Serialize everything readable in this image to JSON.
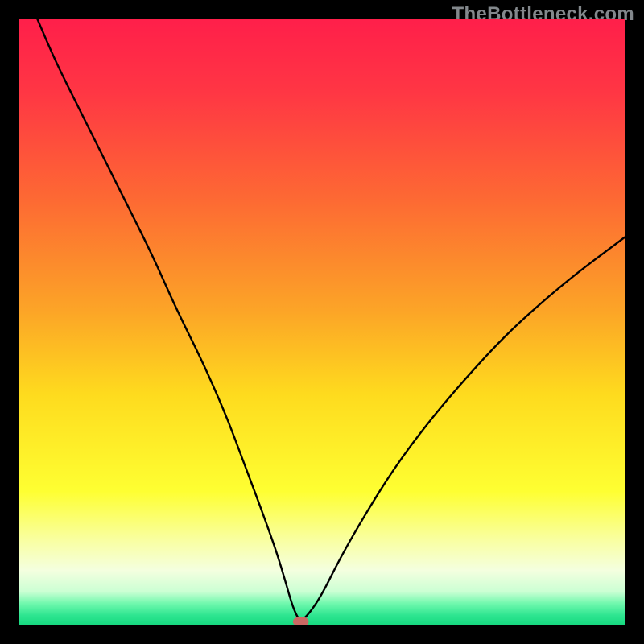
{
  "watermark_text": "TheBottleneck.com",
  "chart_data": {
    "type": "line",
    "title": "",
    "xlabel": "",
    "ylabel": "",
    "xlim": [
      0,
      100
    ],
    "ylim": [
      0,
      100
    ],
    "grid": false,
    "legend": false,
    "gradient_stops": [
      {
        "offset": 0.0,
        "color": "#ff1f4a"
      },
      {
        "offset": 0.12,
        "color": "#ff3644"
      },
      {
        "offset": 0.3,
        "color": "#fd6a33"
      },
      {
        "offset": 0.48,
        "color": "#fca427"
      },
      {
        "offset": 0.62,
        "color": "#fedb1e"
      },
      {
        "offset": 0.78,
        "color": "#feff32"
      },
      {
        "offset": 0.86,
        "color": "#f9ffa1"
      },
      {
        "offset": 0.91,
        "color": "#f4ffdf"
      },
      {
        "offset": 0.945,
        "color": "#ccffd4"
      },
      {
        "offset": 0.965,
        "color": "#70f8ad"
      },
      {
        "offset": 0.985,
        "color": "#2de590"
      },
      {
        "offset": 1.0,
        "color": "#17d980"
      }
    ],
    "series": [
      {
        "name": "bottleneck-curve",
        "color": "#000000",
        "x": [
          3,
          6,
          10,
          14,
          18,
          22,
          26,
          30,
          34,
          37,
          40,
          42.5,
          44,
          45,
          45.8,
          46.5,
          46.5,
          48,
          50,
          53,
          57,
          62,
          68,
          74,
          80,
          86,
          92,
          98,
          100
        ],
        "y": [
          100,
          93,
          85,
          77,
          69,
          61,
          52,
          44,
          35,
          27,
          19,
          12,
          7,
          3.5,
          1.5,
          0.5,
          0.5,
          2,
          5,
          11,
          18,
          26,
          34,
          41,
          47.5,
          53,
          58,
          62.5,
          64
        ]
      }
    ],
    "marker": {
      "name": "optimal-point",
      "x": 46.5,
      "y": 0.5,
      "color": "#ca6863"
    }
  }
}
